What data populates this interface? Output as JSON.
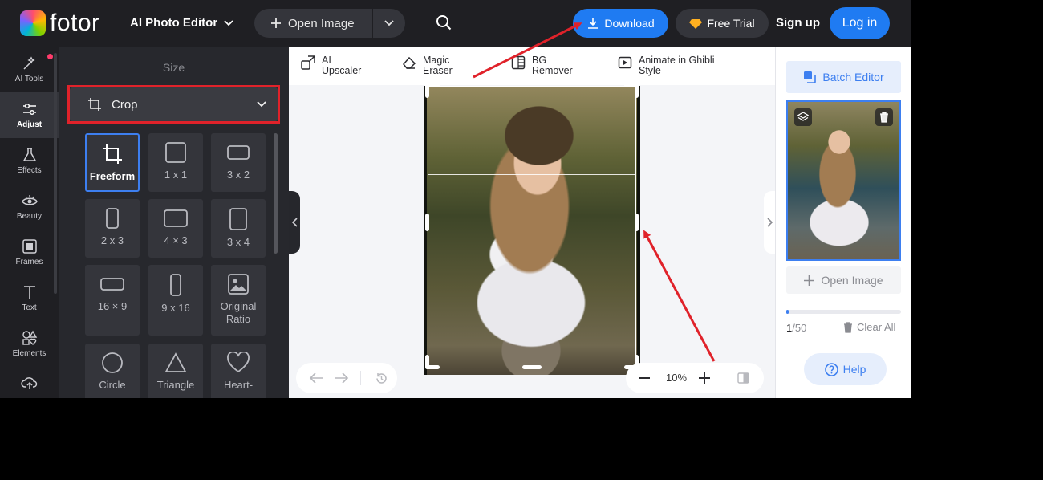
{
  "header": {
    "brand": "fotor",
    "app_menu": "AI Photo Editor",
    "open_image": "Open Image",
    "download": "Download",
    "free_trial": "Free Trial",
    "sign_up": "Sign up",
    "log_in": "Log in"
  },
  "rail": {
    "items": [
      {
        "label": "AI Tools",
        "icon": "sparkle-icon"
      },
      {
        "label": "Adjust",
        "icon": "sliders-icon"
      },
      {
        "label": "Effects",
        "icon": "flask-icon"
      },
      {
        "label": "Beauty",
        "icon": "eye-icon"
      },
      {
        "label": "Frames",
        "icon": "frame-icon"
      },
      {
        "label": "Text",
        "icon": "text-icon"
      },
      {
        "label": "Elements",
        "icon": "shapes-icon"
      }
    ]
  },
  "panel": {
    "title": "Size",
    "crop_label": "Crop",
    "ratios": [
      {
        "label": "Freeform"
      },
      {
        "label": "1 x 1"
      },
      {
        "label": "3 x 2"
      },
      {
        "label": "2 x 3"
      },
      {
        "label": "4 × 3"
      },
      {
        "label": "3 x 4"
      },
      {
        "label": "16 × 9"
      },
      {
        "label": "9 x 16"
      },
      {
        "label": "Original Ratio"
      },
      {
        "label": "Circle"
      },
      {
        "label": "Triangle"
      },
      {
        "label": "Heart-"
      }
    ]
  },
  "toolstrip": {
    "upscaler": "AI Upscaler",
    "eraser": "Magic Eraser",
    "bg_remover": "BG Remover",
    "ghibli": "Animate in Ghibli Style"
  },
  "canvas": {
    "zoom": "10%"
  },
  "right": {
    "batch_editor": "Batch Editor",
    "open_image": "Open Image",
    "count_current": "1",
    "count_total": "/50",
    "clear_all": "Clear All",
    "help": "Help",
    "progress_fraction": 0.02
  },
  "colors": {
    "accent": "#1f7bf2",
    "highlight_red": "#e0222a"
  }
}
